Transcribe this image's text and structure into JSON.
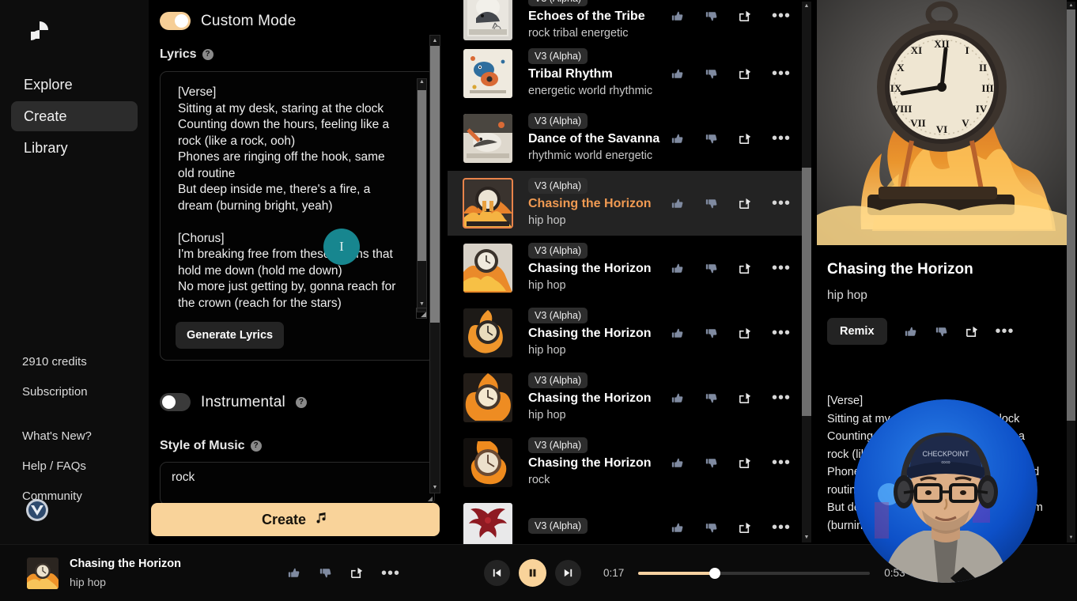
{
  "sidebar": {
    "logo_name": "suno-logo",
    "nav": [
      {
        "label": "Explore",
        "active": false
      },
      {
        "label": "Create",
        "active": true
      },
      {
        "label": "Library",
        "active": false
      }
    ],
    "credits": "2910 credits",
    "subscription": "Subscription",
    "links": [
      {
        "label": "What's New?"
      },
      {
        "label": "Help / FAQs"
      },
      {
        "label": "Community"
      }
    ],
    "badge_name": "community-badge-icon"
  },
  "create_panel": {
    "custom_mode": {
      "label": "Custom Mode",
      "on": true
    },
    "lyrics": {
      "label": "Lyrics",
      "help_icon": "question-mark-icon",
      "value": "[Verse]\nSitting at my desk, staring at the clock\nCounting down the hours, feeling like a\nrock (like a rock, ooh)\nPhones are ringing off the hook, same\nold routine\nBut deep inside me, there's a fire, a\ndream (burning bright, yeah)\n\n[Chorus]\nI'm breaking free from these chains that\nhold me down (hold me down)\nNo more just getting by, gonna reach for\nthe crown (reach for the stars)\nI'm chasing the horizon, gonna follow my",
      "generate_button": "Generate Lyrics"
    },
    "instrumental": {
      "label": "Instrumental",
      "on": false,
      "help_icon": "question-mark-icon"
    },
    "style_of_music": {
      "label": "Style of Music",
      "help_icon": "question-mark-icon",
      "value": "rock"
    },
    "create_button": {
      "label": "Create",
      "icon": "music-note-icon"
    }
  },
  "song_list": [
    {
      "version": "V3 (Alpha)",
      "title": "Echoes of the Tribe",
      "style": "rock tribal energetic",
      "art": "bird-engraving",
      "selected": false
    },
    {
      "version": "V3 (Alpha)",
      "title": "Tribal Rhythm",
      "style": "energetic world rhythmic",
      "art": "bird-banjo",
      "selected": false
    },
    {
      "version": "V3 (Alpha)",
      "title": "Dance of the Savanna",
      "style": "rhythmic world energetic",
      "art": "bird-collage",
      "selected": false
    },
    {
      "version": "V3 (Alpha)",
      "title": "Chasing the Horizon",
      "style": "hip hop",
      "art": "burning-clock-1",
      "selected": true
    },
    {
      "version": "V3 (Alpha)",
      "title": "Chasing the Horizon",
      "style": "hip hop",
      "art": "burning-clock-2",
      "selected": false
    },
    {
      "version": "V3 (Alpha)",
      "title": "Chasing the Horizon",
      "style": "hip hop",
      "art": "burning-clock-3",
      "selected": false
    },
    {
      "version": "V3 (Alpha)",
      "title": "Chasing the Horizon",
      "style": "hip hop",
      "art": "burning-clock-4",
      "selected": false
    },
    {
      "version": "V3 (Alpha)",
      "title": "Chasing the Horizon",
      "style": "rock",
      "art": "burning-clock-5",
      "selected": false
    },
    {
      "version": "V3 (Alpha)",
      "title": "",
      "style": "",
      "art": "red-phoenix",
      "selected": false
    }
  ],
  "row_icons": {
    "like": "thumbs-up-icon",
    "dislike": "thumbs-down-icon",
    "share": "share-icon",
    "more": "more-options-icon"
  },
  "detail": {
    "cover_art": "burning-clock-large",
    "title": "Chasing the Horizon",
    "style": "hip hop",
    "remix_button": "Remix",
    "lyrics": "[Verse]\nSitting at my desk, staring at the clock\nCounting down the hours, feeling like a\nrock (like a rock, ooh)\nPhones are ringing off the hook, same old\nroutine\nBut deep inside me, there's a fire, a dream\n(burning bright, yeah)"
  },
  "player": {
    "title": "Chasing the Horizon",
    "style": "hip hop",
    "current_time": "0:17",
    "total_time": "0:53",
    "progress_percent": 33,
    "is_playing": true,
    "prev_icon": "skip-previous-icon",
    "play_pause_icon": "pause-icon",
    "next_icon": "skip-next-icon",
    "shuffle_icon": "shuffle-icon",
    "repeat_icon": "repeat-icon"
  },
  "overlay": {
    "webcam": "webcam-presenter-circle",
    "cursor": "text-cursor-highlight"
  },
  "colors": {
    "accent": "#f9d39a",
    "selected_title": "#f09a52",
    "shuffle_active": "#e0a96b",
    "cursor_blob": "#17868f",
    "row_selected_bg": "#232323"
  }
}
